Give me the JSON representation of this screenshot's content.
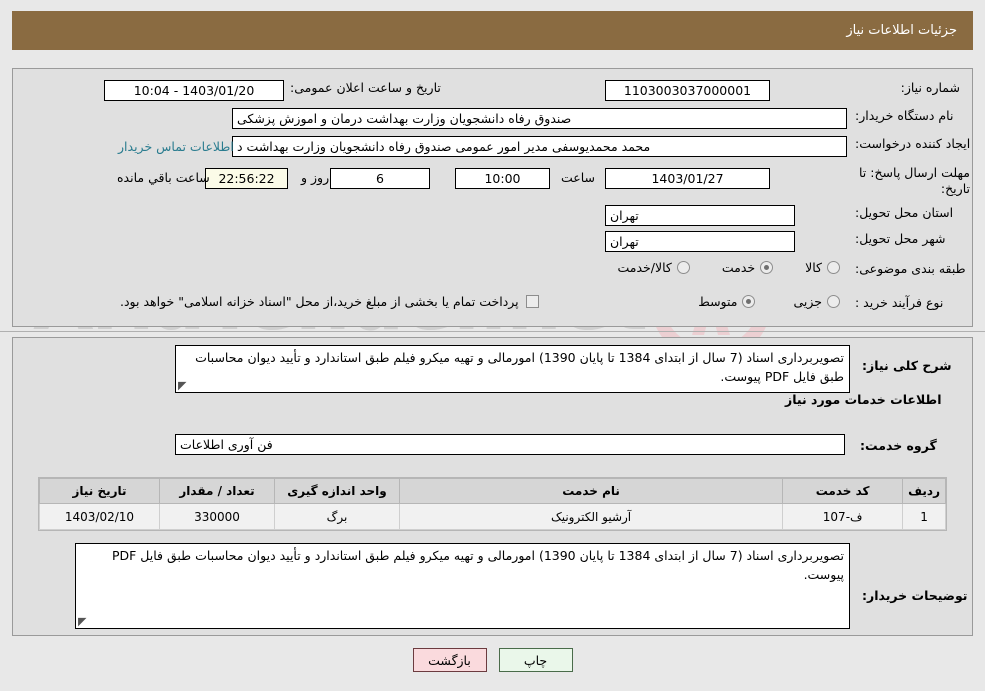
{
  "header": {
    "title": "جزئیات اطلاعات نیاز"
  },
  "form": {
    "need_number": {
      "label": "شماره نیاز:",
      "value": "1103003037000001"
    },
    "announce_datetime": {
      "label": "تاریخ و ساعت اعلان عمومی:",
      "value": "1403/01/20 - 10:04"
    },
    "buyer_org": {
      "label": "نام دستگاه خریدار:",
      "value": "صندوق رفاه دانشجویان وزارت بهداشت  درمان و اموزش پزشکی"
    },
    "requester": {
      "label": "ایجاد کننده درخواست:",
      "value": "محمد محمدیوسفی مدیر امور عمومی صندوق رفاه دانشجویان وزارت بهداشت  د",
      "contact_link": "اطلاعات تماس خریدار"
    },
    "deadline": {
      "label": "مهلت ارسال پاسخ: تا تاریخ:",
      "date": "1403/01/27",
      "time_label": "ساعت",
      "time": "10:00",
      "days": "6",
      "days_label": "روز و",
      "countdown": "22:56:22",
      "countdown_label": "ساعت باقي مانده"
    },
    "province": {
      "label": "استان محل تحویل:",
      "value": "تهران"
    },
    "city": {
      "label": "شهر محل تحویل:",
      "value": "تهران"
    },
    "category": {
      "label": "طبقه بندی موضوعی:",
      "options": [
        {
          "label": "کالا",
          "selected": false
        },
        {
          "label": "خدمت",
          "selected": true
        },
        {
          "label": "کالا/خدمت",
          "selected": false
        }
      ]
    },
    "purchase_type": {
      "label": "نوع فرآیند خرید :",
      "options": [
        {
          "label": "جزیی",
          "selected": false
        },
        {
          "label": "متوسط",
          "selected": true
        }
      ],
      "checkbox_label": "پرداخت تمام یا بخشی از مبلغ خرید،از محل \"اسناد خزانه اسلامی\" خواهد بود.",
      "checkbox_checked": false
    }
  },
  "description": {
    "label": "شرح کلی نیاز:",
    "value": "تصویربرداری اسناد (7 سال از ابتدای 1384 تا پایان 1390) امورمالی و تهیه میکرو فیلم طبق استاندارد و تأیید دیوان محاسبات طبق فایل PDF پیوست."
  },
  "services_section": {
    "heading": "اطلاعات خدمات مورد نیاز",
    "group_label": "گروه خدمت:",
    "group_value": "فن آوری اطلاعات"
  },
  "table": {
    "columns": [
      "ردیف",
      "کد خدمت",
      "نام خدمت",
      "واحد اندازه گیری",
      "تعداد / مقدار",
      "تاریخ نیاز"
    ],
    "rows": [
      {
        "row_no": "1",
        "service_code": "ف-107",
        "service_name": "آرشیو الکترونیک",
        "unit": "برگ",
        "quantity": "330000",
        "need_date": "1403/02/10"
      }
    ]
  },
  "buyer_notes": {
    "label": "توضیحات خریدار:",
    "value": "تصویربرداری اسناد (7 سال از ابتدای 1384 تا پایان 1390) امورمالی و تهیه میکرو فیلم طبق استاندارد و تأیید دیوان محاسبات طبق فایل PDF پیوست."
  },
  "buttons": {
    "back": "بازگشت",
    "print": "چاپ"
  },
  "watermark": {
    "text": "AriaTender.net"
  },
  "colors": {
    "header_bg": "#8a6b41",
    "panel_bg": "#e0e0e0",
    "page_bg": "#e8e8e8",
    "link": "#2a7c8f",
    "back_btn": "#fadadd",
    "print_btn": "#eaf7ea",
    "countdown_bg": "#fbfbe8"
  }
}
